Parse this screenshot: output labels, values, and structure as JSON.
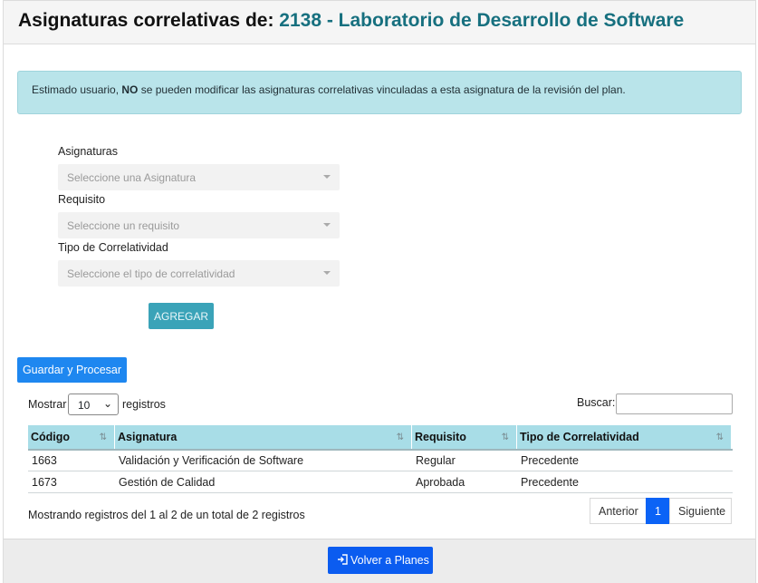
{
  "header": {
    "title_prefix": "Asignaturas correlativas de: ",
    "subject": "2138 - Laboratorio de Desarrollo de Software"
  },
  "alert": {
    "prefix": "Estimado usuario, ",
    "bold": "NO",
    "suffix": " se pueden modificar las asignaturas correlativas vinculadas a esta asignatura de la revisión del plan."
  },
  "form": {
    "asignaturas_label": "Asignaturas",
    "asignaturas_placeholder": "Seleccione una Asignatura",
    "requisito_label": "Requisito",
    "requisito_placeholder": "Seleccione un requisito",
    "tipo_label": "Tipo de Correlatividad",
    "tipo_placeholder": "Seleccione el tipo de correlatividad",
    "agregar_label": "AGREGAR"
  },
  "guardar_label": "Guardar y Procesar",
  "table_controls": {
    "show_prefix": "Mostrar",
    "page_size": "10",
    "show_suffix": "registros",
    "search_label": "Buscar:"
  },
  "table": {
    "columns": [
      "Código",
      "Asignatura",
      "Requisito",
      "Tipo de Correlatividad"
    ],
    "rows": [
      [
        "1663",
        "Validación y Verificación de Software",
        "Regular",
        "Precedente"
      ],
      [
        "1673",
        "Gestión de Calidad",
        "Aprobada",
        "Precedente"
      ]
    ]
  },
  "info": "Mostrando registros del 1 al 2 de un total de 2 registros",
  "pagination": {
    "prev": "Anterior",
    "page": "1",
    "next": "Siguiente"
  },
  "footer": {
    "volver_label": "Volver a Planes",
    "volver_icon": "sign-in-icon"
  },
  "colors": {
    "accent": "#17707f",
    "primary": "#1e87f0",
    "alert_bg": "#b9e4ea",
    "header_bg": "#a8dde7"
  }
}
